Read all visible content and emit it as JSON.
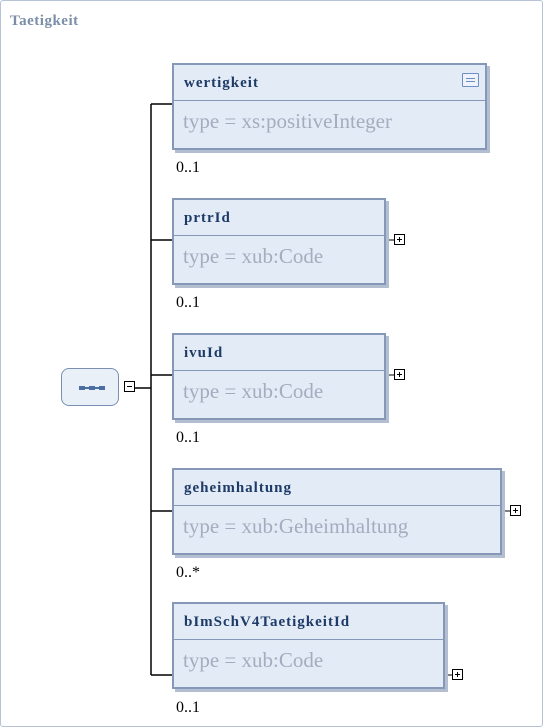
{
  "title": "Taetigkeit",
  "elements": [
    {
      "name": "wertigkeit",
      "type": "type = xs:positiveInteger",
      "cardinality": "0..1",
      "has_annotation": true,
      "expandable": false
    },
    {
      "name": "prtrId",
      "type": "type = xub:Code",
      "cardinality": "0..1",
      "has_annotation": false,
      "expandable": true
    },
    {
      "name": "ivuId",
      "type": "type = xub:Code",
      "cardinality": "0..1",
      "has_annotation": false,
      "expandable": true
    },
    {
      "name": "geheimhaltung",
      "type": "type = xub:Geheimhaltung",
      "cardinality": "0..*",
      "has_annotation": false,
      "expandable": true
    },
    {
      "name": "bImSchV4TaetigkeitId",
      "type": "type = xub:Code",
      "cardinality": "0..1",
      "has_annotation": false,
      "expandable": true
    }
  ],
  "compositor": {
    "kind": "sequence",
    "icon": "sequence-icon",
    "state": "expanded"
  },
  "colors": {
    "title": "#7a8ea8",
    "element_name": "#1e3b68",
    "element_type": "#a3adbf",
    "element_fill": "#e3ebf6",
    "element_border": "#8598b8"
  }
}
